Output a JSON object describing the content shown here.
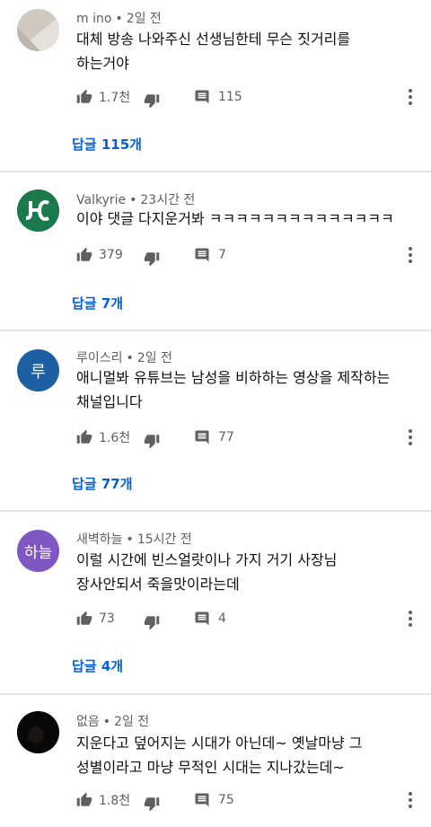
{
  "comments": [
    {
      "author": "m ino",
      "time": "2일 전",
      "lines": [
        "대체 방송 나와주신 선생님한테 무슨 짓거리를",
        "하는거야"
      ],
      "likes": "1.7천",
      "replies": "115",
      "replies_link": "답글 115개",
      "avatar_initial": "",
      "avatar_color": "#d7d2cc"
    },
    {
      "author": "Valkyrie",
      "time": "23시간 전",
      "lines": [
        "이야  댓글 다지운거봐 ㅋㅋㅋㅋㅋㅋㅋㅋㅋㅋㅋㅋㅋㅋ"
      ],
      "likes": "379",
      "replies": "7",
      "replies_link": "답글 7개",
      "avatar_initial": "",
      "avatar_color": "#1a7a4c"
    },
    {
      "author": "루이스리",
      "time": "2일 전",
      "lines": [
        "애니멀봐 유튜브는 남성을 비하하는 영상을 제작하는",
        "채널입니다"
      ],
      "likes": "1.6천",
      "replies": "77",
      "replies_link": "답글 77개",
      "avatar_initial": "루",
      "avatar_color": "#1d5fa3"
    },
    {
      "author": "새벽하늘",
      "time": "15시간 전",
      "lines": [
        "이럴 시간에 빈스얼랏이나 가지 거기 사장님",
        "장사안되서 죽을맛이라는데"
      ],
      "likes": "73",
      "replies": "4",
      "replies_link": "답글 4개",
      "avatar_initial": "하늘",
      "avatar_color": "#7e57c2"
    },
    {
      "author": "없음",
      "time": "2일 전",
      "lines": [
        "지운다고 덮어지는 시대가 아닌데~ 옛날마냥 그",
        "성별이라고 마냥 무적인 시대는 지나갔는데~"
      ],
      "likes": "1.8천",
      "replies": "75",
      "replies_link": "",
      "avatar_initial": "",
      "avatar_color": "#0b0b0b"
    }
  ],
  "theme": {
    "link_color": "#065fd4",
    "secondary_text": "#606060",
    "divider": "#e3e3e3"
  },
  "icons": {
    "like": "thumb-up-icon",
    "dislike": "thumb-down-icon",
    "reply": "comment-icon",
    "more": "more-vert-icon"
  }
}
